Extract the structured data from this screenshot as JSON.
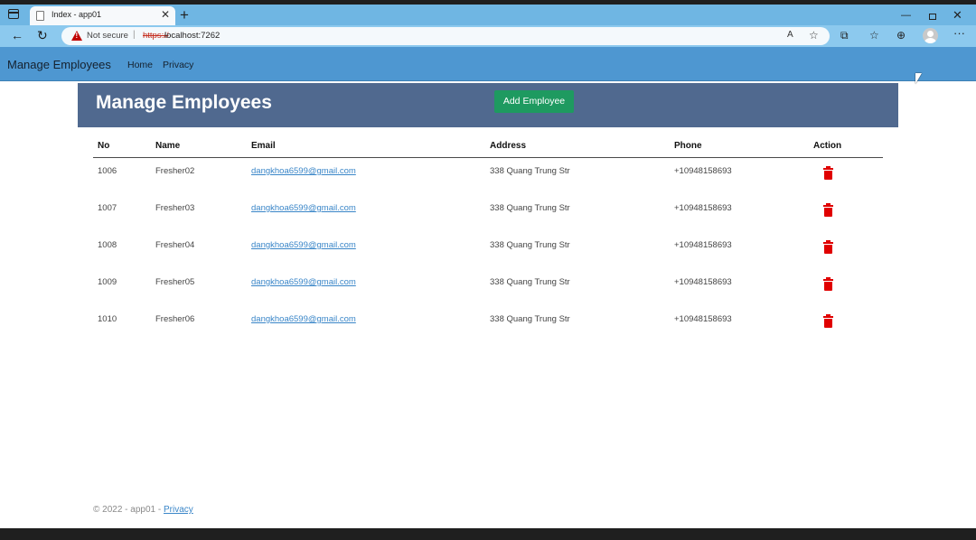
{
  "browser": {
    "tab_title": "Index - app01",
    "security_label": "Not secure",
    "url_scheme": "https://",
    "url_host": "localhost:7262"
  },
  "navbar": {
    "brand": "Manage Employees",
    "links": [
      "Home",
      "Privacy"
    ]
  },
  "header": {
    "title": "Manage Employees",
    "add_button": "Add Employee"
  },
  "table": {
    "columns": [
      "No",
      "Name",
      "Email",
      "Address",
      "Phone",
      "Action"
    ],
    "rows": [
      {
        "no": "1006",
        "name": "Fresher02",
        "email": "dangkhoa6599@gmail.com",
        "address": "338 Quang Trung Str",
        "phone": "+10948158693"
      },
      {
        "no": "1007",
        "name": "Fresher03",
        "email": "dangkhoa6599@gmail.com",
        "address": "338 Quang Trung Str",
        "phone": "+10948158693"
      },
      {
        "no": "1008",
        "name": "Fresher04",
        "email": "dangkhoa6599@gmail.com",
        "address": "338 Quang Trung Str",
        "phone": "+10948158693"
      },
      {
        "no": "1009",
        "name": "Fresher05",
        "email": "dangkhoa6599@gmail.com",
        "address": "338 Quang Trung Str",
        "phone": "+10948158693"
      },
      {
        "no": "1010",
        "name": "Fresher06",
        "email": "dangkhoa6599@gmail.com",
        "address": "338 Quang Trung Str",
        "phone": "+10948158693"
      }
    ]
  },
  "footer": {
    "text": "© 2022 - app01 - ",
    "link": "Privacy"
  },
  "colors": {
    "navbar": "#4e97d1",
    "header": "#50698f",
    "add_button": "#1e9a60",
    "delete_icon": "#e00000",
    "link": "#3a86c8"
  }
}
